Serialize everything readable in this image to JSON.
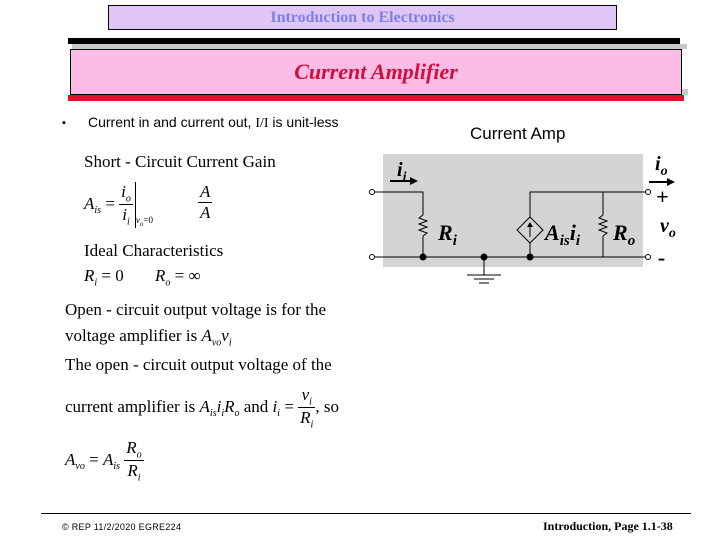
{
  "header": {
    "course_title": "Introduction to Electronics",
    "slide_title": "Current Amplifier",
    "colors": {
      "course_title_bg": "#e0c6f7",
      "course_title_text": "#7b82e6",
      "slide_title_bg": "#fbbde6",
      "slide_title_text": "#d0103c",
      "accent_red": "#e1102f"
    }
  },
  "bullet": {
    "marker": "▪",
    "text_prefix": "Current in and current out, ",
    "text_unit": "I/I",
    "text_suffix": " is unit-less"
  },
  "left_content": {
    "short_circuit_heading": "Short - Circuit Current Gain",
    "gain_def": {
      "lhs": "A",
      "lhs_sub": "is",
      "num": "i",
      "num_sub": "o",
      "den": "i",
      "den_sub": "i",
      "cond": "v",
      "cond_sub": "o",
      "cond_val": "=0",
      "unit_num": "A",
      "unit_den": "A"
    },
    "ideal_heading": "Ideal Characteristics",
    "ideal_ri": {
      "sym": "R",
      "sub": "i",
      "val": " = 0"
    },
    "ideal_ro": {
      "sym": "R",
      "sub": "o",
      "val": " = ∞"
    },
    "para_line1": "Open - circuit output voltage is for the",
    "para_line2_prefix": "voltage amplifier is ",
    "para_line2_expr": {
      "sym": "A",
      "sub": "vo",
      "var": "v",
      "var_sub": "i"
    },
    "para_line3": "The open - circuit output voltage of the",
    "para_line4_prefix": "current amplifier is ",
    "para_line4_expr": "A",
    "para_line4_expr_sub": "is",
    "para_line4_mid": "i",
    "para_line4_mid_sub": "i",
    "para_line4_R": "R",
    "para_line4_R_sub": "o",
    "para_line4_and": " and ",
    "para_line4_ii": "i",
    "para_line4_ii_sub": "i",
    "para_line4_eq": " = ",
    "para_line4_fnum": "v",
    "para_line4_fnum_sub": "i",
    "para_line4_fden": "R",
    "para_line4_fden_sub": "i",
    "para_line4_suffix": ", so",
    "result": {
      "lhs": "A",
      "lhs_sub": "vo",
      "eq": " = ",
      "rhs": "A",
      "rhs_sub": "is",
      "num": "R",
      "num_sub": "o",
      "den": "R",
      "den_sub": "i"
    }
  },
  "circuit": {
    "title": "Current Amp",
    "input_current": {
      "sym": "i",
      "sub": "i"
    },
    "output_current": {
      "sym": "i",
      "sub": "o"
    },
    "input_resistor": {
      "sym": "R",
      "sub": "i"
    },
    "output_resistor": {
      "sym": "R",
      "sub": "o"
    },
    "source": {
      "sym": "A",
      "sub": "is",
      "var": "i",
      "var_sub": "i"
    },
    "output_voltage": {
      "sym": "v",
      "sub": "o"
    },
    "plus": "+",
    "minus": "-",
    "box_color": "#d4d4d4"
  },
  "footer": {
    "left": "© REP  11/2/2020  EGRE224",
    "right": "Introduction, Page 1.1-38"
  }
}
